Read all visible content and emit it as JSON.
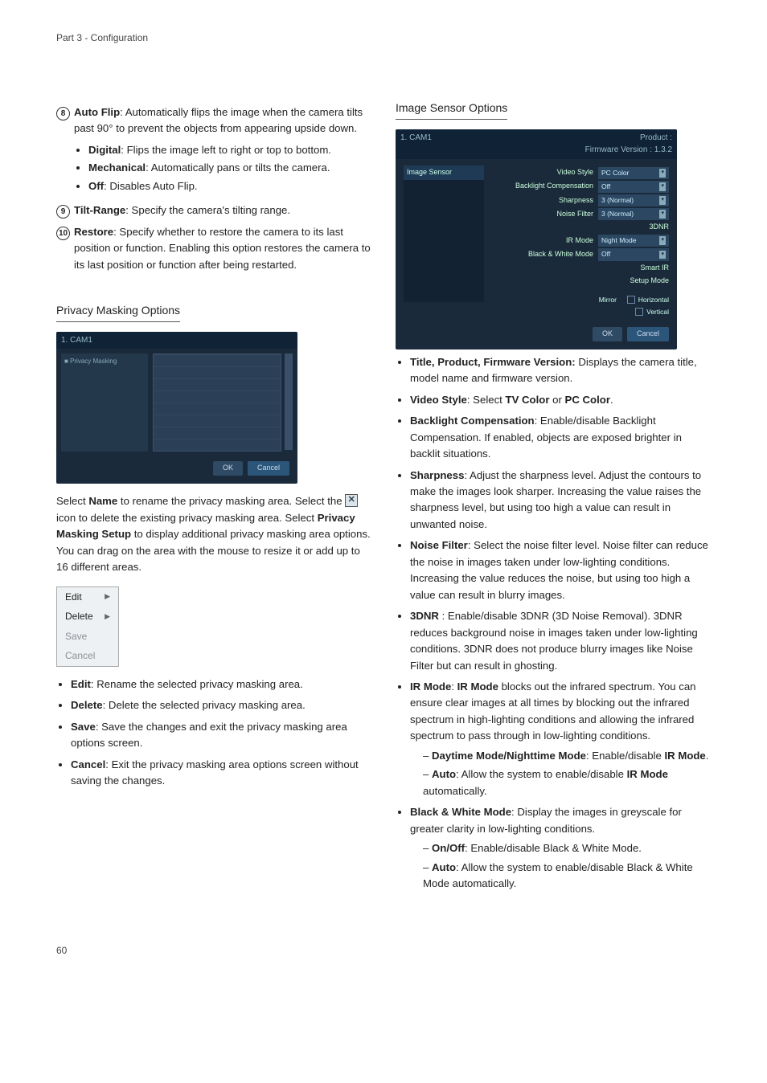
{
  "running_head": "Part 3 - Configuration",
  "page_number": "60",
  "left": {
    "item8_num": "8",
    "item8": "Auto Flip: Automatically flips the image when the camera tilts past 90° to prevent the objects from appearing upside down.",
    "item8_bold": "Auto Flip",
    "item8_rest": ": Automatically flips the image when the camera tilts past 90° to prevent the objects from appearing upside down.",
    "item8_subs": [
      {
        "b": "Digital",
        "t": ": Flips the image left to right or top to bottom."
      },
      {
        "b": "Mechanical",
        "t": ": Automatically pans or tilts the camera."
      },
      {
        "b": "Off",
        "t": ": Disables Auto Flip."
      }
    ],
    "item9_num": "9",
    "item9_bold": "Tilt-Range",
    "item9_rest": ": Specify the camera's tilting range.",
    "item10_num": "10",
    "item10_bold": "Restore",
    "item10_rest": ": Specify whether to restore the camera to its last position or function. Enabling this option restores the camera to its last position or function after being restarted.",
    "privacy_title": "Privacy Masking Options",
    "pm_shot": {
      "title": "1. CAM1",
      "side_label": "■ Privacy Masking",
      "ok": "OK",
      "cancel": "Cancel"
    },
    "pm_para_a": "Select ",
    "pm_para_b": "Name",
    "pm_para_c": " to rename the privacy masking area. Select the ",
    "pm_para_d": " icon to delete the existing privacy masking area. Select ",
    "pm_para_e": "Privacy Masking Setup",
    "pm_para_f": " to display additional privacy masking area options. You can drag on the area with the mouse to resize it or add up to 16 different areas.",
    "ctxmenu": {
      "edit": "Edit",
      "delete": "Delete",
      "save": "Save",
      "cancel": "Cancel"
    },
    "pm_list": [
      {
        "b": "Edit",
        "t": ": Rename the selected privacy masking area."
      },
      {
        "b": "Delete",
        "t": ": Delete the selected privacy masking area."
      },
      {
        "b": "Save",
        "t": ": Save the changes and exit the privacy masking area options screen."
      },
      {
        "b": "Cancel",
        "t": ": Exit the privacy masking area options screen without saving the changes."
      }
    ]
  },
  "right": {
    "title": "Image Sensor Options",
    "shot": {
      "title": "1. CAM1",
      "side_label": "Image Sensor",
      "product_label": "Product :",
      "fw_label": "Firmware Version : 1.3.2",
      "rows": [
        {
          "lbl": "Video Style",
          "val": "PC Color"
        },
        {
          "lbl": "Backlight Compensation",
          "val": "Off"
        },
        {
          "lbl": "Sharpness",
          "val": "3 (Normal)"
        },
        {
          "lbl": "Noise Filter",
          "val": "3 (Normal)"
        },
        {
          "lbl": "3DNR",
          "val": ""
        },
        {
          "lbl": "IR Mode",
          "val": "Night Mode"
        },
        {
          "lbl": "Black & White Mode",
          "val": "Off"
        },
        {
          "lbl": "Smart IR",
          "val": ""
        },
        {
          "lbl": "Setup Mode",
          "val": ""
        }
      ],
      "mirror_label": "Mirror",
      "mirror_h": "Horizontal",
      "mirror_v": "Vertical",
      "ok": "OK",
      "cancel": "Cancel"
    },
    "bul_title_b": "Title, Product, Firmware Version:",
    "bul_title_t": " Displays the camera title, model name and firmware version.",
    "bul_vs_a": "Video Style",
    "bul_vs_b": ": Select ",
    "bul_vs_c": "TV Color",
    "bul_vs_d": " or ",
    "bul_vs_e": "PC Color",
    "bul_vs_f": ".",
    "bul_bc_b": "Backlight Compensation",
    "bul_bc_t": ": Enable/disable Backlight Compensation. If enabled, objects are exposed brighter in backlit situations.",
    "bul_sh_b": "Sharpness",
    "bul_sh_t": ": Adjust the sharpness level. Adjust the contours to make the images look sharper. Increasing the value raises the sharpness level, but using too high a value can result in unwanted noise.",
    "bul_nf_b": "Noise Filter",
    "bul_nf_t": ": Select the noise filter level. Noise filter can reduce the noise in images taken under low-lighting conditions. Increasing the value reduces the noise, but using too high a value can result in blurry images.",
    "bul_3d_b": "3DNR",
    "bul_3d_t": " : Enable/disable 3DNR (3D Noise Removal). 3DNR reduces background noise in images taken under low-lighting conditions. 3DNR does not produce blurry images like Noise Filter but can result in ghosting.",
    "bul_ir_a": "IR Mode",
    "bul_ir_b": ": ",
    "bul_ir_c": "IR Mode",
    "bul_ir_d": " blocks out the infrared spectrum. You can ensure clear images at all times by blocking out the infrared spectrum in high-lighting conditions and allowing the infrared spectrum to pass through in low-lighting conditions.",
    "bul_ir_sub1_a": "Daytime Mode/Nighttime Mode",
    "bul_ir_sub1_b": ": Enable/disable ",
    "bul_ir_sub1_c": "IR Mode",
    "bul_ir_sub1_d": ".",
    "bul_ir_sub2_a": "Auto",
    "bul_ir_sub2_b": ": Allow the system to enable/disable ",
    "bul_ir_sub2_c": "IR Mode",
    "bul_ir_sub2_d": " automatically.",
    "bul_bw_b": "Black & White Mode",
    "bul_bw_t": ": Display the images in greyscale for greater clarity in low-lighting conditions.",
    "bul_bw_sub1_b": "On/Off",
    "bul_bw_sub1_t": ": Enable/disable Black & White Mode.",
    "bul_bw_sub2_b": "Auto",
    "bul_bw_sub2_t": ": Allow the system to enable/disable Black & White Mode automatically."
  }
}
